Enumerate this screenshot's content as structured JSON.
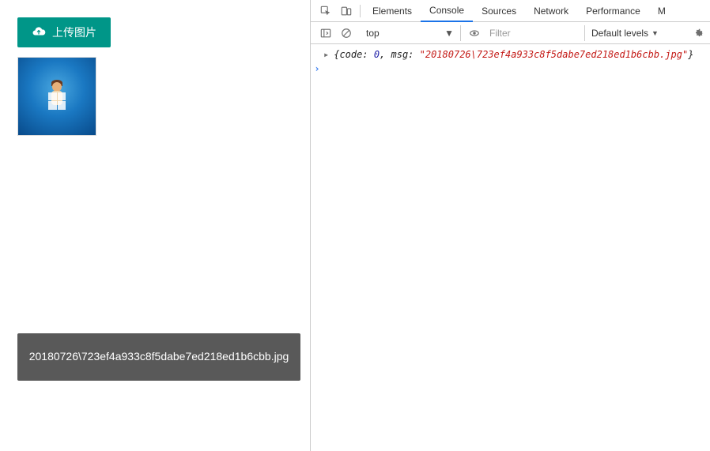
{
  "upload_button_label": "上传图片",
  "toast_text": "20180726\\723ef4a933c8f5dabe7ed218ed1b6cbb.jpg",
  "devtools": {
    "tabs": [
      "Elements",
      "Console",
      "Sources",
      "Network",
      "Performance",
      "M"
    ],
    "active_tab": "Console",
    "context": "top",
    "filter_placeholder": "Filter",
    "levels_label": "Default levels",
    "log": {
      "prefix": "{code: ",
      "code": "0",
      "mid": ", msg: ",
      "msg": "\"20180726\\723ef4a933c8f5dabe7ed218ed1b6cbb.jpg\"",
      "suffix": "}"
    }
  }
}
